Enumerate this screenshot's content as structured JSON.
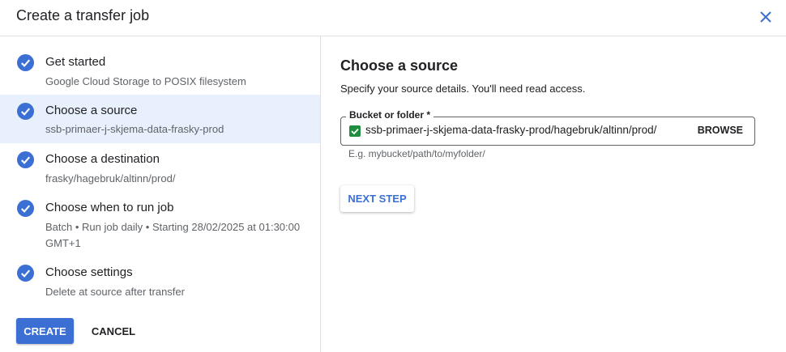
{
  "dialog": {
    "title": "Create a transfer job"
  },
  "steps": [
    {
      "title": "Get started",
      "subtitle": "Google Cloud Storage to POSIX filesystem"
    },
    {
      "title": "Choose a source",
      "subtitle": "ssb-primaer-j-skjema-data-frasky-prod"
    },
    {
      "title": "Choose a destination",
      "subtitle": "frasky/hagebruk/altinn/prod/"
    },
    {
      "title": "Choose when to run job",
      "subtitle": "Batch • Run job daily • Starting 28/02/2025 at 01:30:00 GMT+1"
    },
    {
      "title": "Choose settings",
      "subtitle": "Delete at source after transfer"
    }
  ],
  "actions": {
    "create_label": "CREATE",
    "cancel_label": "CANCEL"
  },
  "source": {
    "title": "Choose a source",
    "description": "Specify your source details. You'll need read access.",
    "field_label": "Bucket or folder *",
    "field_value": "ssb-primaer-j-skjema-data-frasky-prod/hagebruk/altinn/prod/",
    "browse_label": "BROWSE",
    "hint": "E.g. mybucket/path/to/myfolder/",
    "next_label": "NEXT STEP"
  },
  "colors": {
    "accent": "#3b6fd4",
    "active_bg": "#e8f0fe",
    "valid": "#1e8e3e"
  },
  "icons": {
    "close": "close-icon",
    "step_done": "check-circle-icon",
    "field_valid": "check-box-icon"
  }
}
